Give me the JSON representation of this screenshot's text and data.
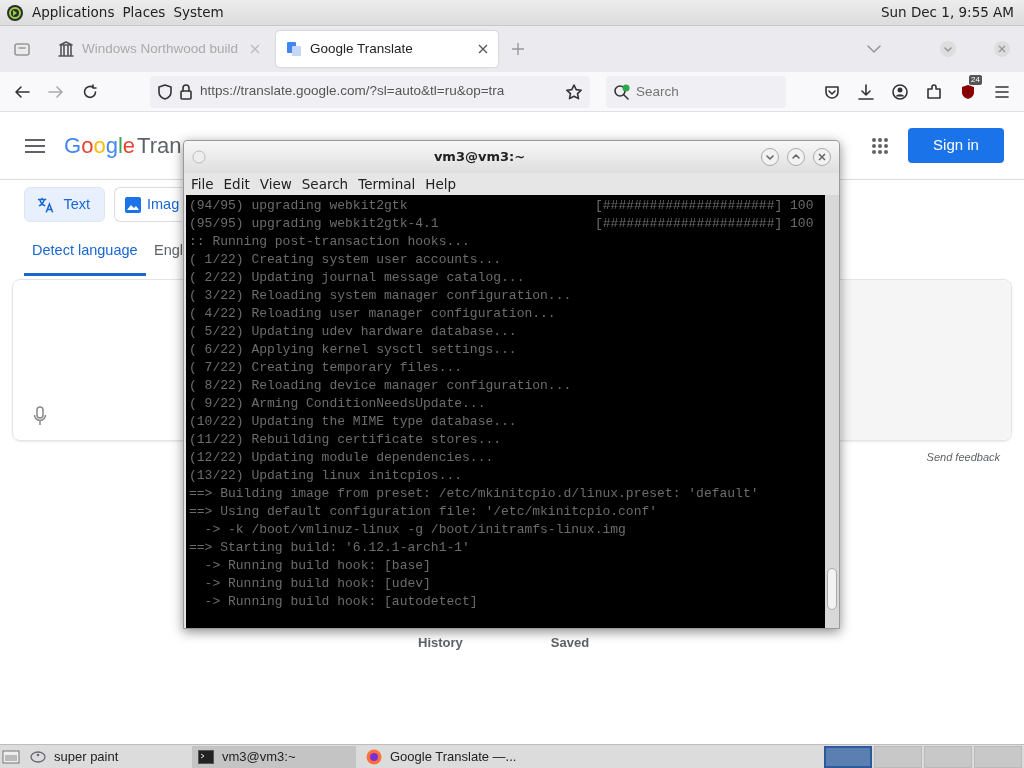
{
  "top_panel": {
    "menus": [
      "Applications",
      "Places",
      "System"
    ],
    "clock": "Sun Dec 1, 9:55 AM"
  },
  "browser": {
    "tabs": [
      {
        "title": "Windows Northwood build",
        "selected": false,
        "kind": "museum"
      },
      {
        "title": "Google Translate",
        "selected": true,
        "kind": "translate"
      }
    ],
    "forward_disabled": true,
    "url": "https://translate.google.com/?sl=auto&tl=ru&op=tra",
    "search": {
      "placeholder": "Search"
    },
    "extension_badge": "24"
  },
  "page": {
    "logo": "Google",
    "product": "Tran",
    "sign_in": "Sign in",
    "modes": [
      {
        "label": "Text",
        "selected": true,
        "kind": "text"
      },
      {
        "label": "Imag",
        "selected": false,
        "kind": "image"
      }
    ],
    "languages": [
      {
        "label": "Detect language",
        "selected": true
      },
      {
        "label": "Engl",
        "selected": false
      }
    ],
    "send_feedback": "Send feedback",
    "bottom_links": [
      "History",
      "Saved"
    ]
  },
  "terminal": {
    "title": "vm3@vm3:~",
    "menu": [
      "File",
      "Edit",
      "View",
      "Search",
      "Terminal",
      "Help"
    ],
    "lines": [
      {
        "text": "(94/95) upgrading webkit2gtk",
        "progress": "[######################] 100"
      },
      {
        "text": "(95/95) upgrading webkit2gtk-4.1",
        "progress": "[######################] 100"
      },
      {
        "text": ":: Running post-transaction hooks..."
      },
      {
        "text": "( 1/22) Creating system user accounts..."
      },
      {
        "text": "( 2/22) Updating journal message catalog..."
      },
      {
        "text": "( 3/22) Reloading system manager configuration..."
      },
      {
        "text": "( 4/22) Reloading user manager configuration..."
      },
      {
        "text": "( 5/22) Updating udev hardware database..."
      },
      {
        "text": "( 6/22) Applying kernel sysctl settings..."
      },
      {
        "text": "( 7/22) Creating temporary files..."
      },
      {
        "text": "( 8/22) Reloading device manager configuration..."
      },
      {
        "text": "( 9/22) Arming ConditionNeedsUpdate..."
      },
      {
        "text": "(10/22) Updating the MIME type database..."
      },
      {
        "text": "(11/22) Rebuilding certificate stores..."
      },
      {
        "text": "(12/22) Updating module dependencies..."
      },
      {
        "text": "(13/22) Updating linux initcpios..."
      },
      {
        "text": "==> Building image from preset: /etc/mkinitcpio.d/linux.preset: 'default'"
      },
      {
        "text": "==> Using default configuration file: '/etc/mkinitcpio.conf'"
      },
      {
        "text": "  -> -k /boot/vmlinuz-linux -g /boot/initramfs-linux.img"
      },
      {
        "text": "==> Starting build: '6.12.1-arch1-1'"
      },
      {
        "text": "  -> Running build hook: [base]"
      },
      {
        "text": "  -> Running build hook: [udev]"
      },
      {
        "text": "  -> Running build hook: [autodetect]"
      }
    ]
  },
  "taskbar": {
    "items": [
      {
        "label": "super paint",
        "selected": false,
        "kind": "paint"
      },
      {
        "label": "vm3@vm3:~",
        "selected": true,
        "kind": "terminal"
      },
      {
        "label": "Google Translate —...",
        "selected": false,
        "kind": "browser"
      }
    ]
  }
}
